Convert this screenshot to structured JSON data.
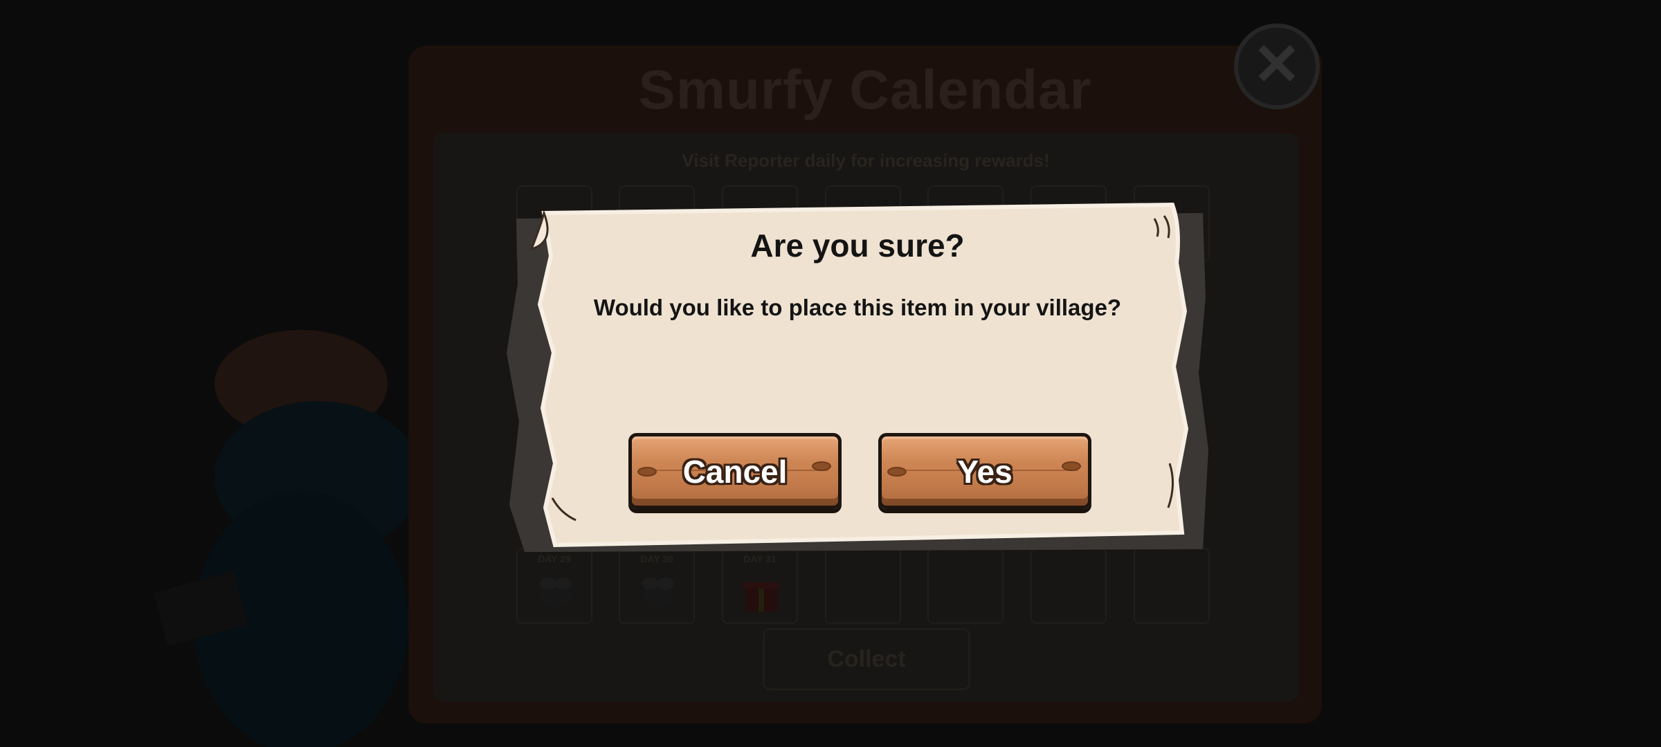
{
  "background": {
    "calendar": {
      "title": "Smurfy Calendar",
      "subtitle": "Visit Reporter daily for increasing rewards!",
      "bottom_days": [
        "DAY 29",
        "DAY 30",
        "DAY 31"
      ],
      "collect_label": "Collect"
    }
  },
  "modal": {
    "title": "Are you sure?",
    "message": "Would you like to place this item in your village?",
    "cancel_label": "Cancel",
    "yes_label": "Yes"
  },
  "colors": {
    "parchment": "#efe2d1",
    "parchment_shadow": "#3a3734",
    "wood": "#cf8756",
    "backdrop": "#0b0b0b"
  },
  "icons": [
    "close-icon",
    "bee-icon",
    "gift-icon"
  ]
}
